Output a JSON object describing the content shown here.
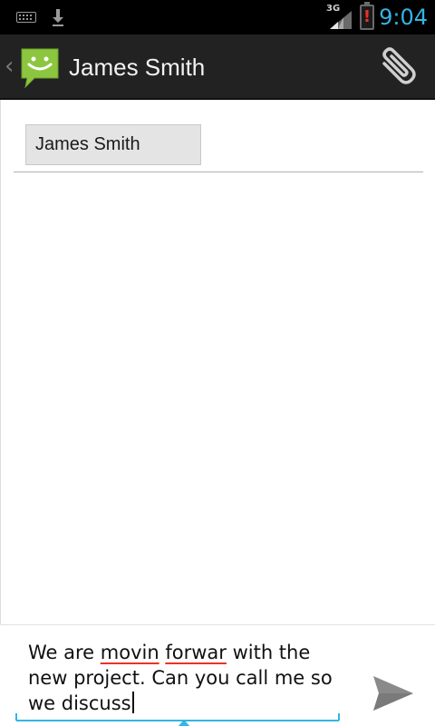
{
  "status_bar": {
    "network_type": "3G",
    "battery_alert": "!",
    "time": "9:04",
    "icons": [
      "keyboard-icon",
      "download-icon",
      "signal-icon",
      "battery-alert-icon"
    ]
  },
  "action_bar": {
    "back_glyph": "‹",
    "title": "James Smith",
    "icons": [
      "messaging-app-icon",
      "paperclip-icon"
    ]
  },
  "recipients": [
    {
      "name": "James Smith"
    }
  ],
  "composer": {
    "segments": [
      {
        "text": "We are ",
        "misspelled": false
      },
      {
        "text": "movin",
        "misspelled": true
      },
      {
        "text": " ",
        "misspelled": false
      },
      {
        "text": "forwar",
        "misspelled": true
      },
      {
        "text": " with the new project. Can you call me so we discuss",
        "misspelled": false
      }
    ],
    "send_icon": "send-icon"
  },
  "colors": {
    "accent": "#33b5e5",
    "action_bar": "#222222",
    "app_icon_green": "#8cc63f",
    "spelling_error": "#e8322a"
  }
}
